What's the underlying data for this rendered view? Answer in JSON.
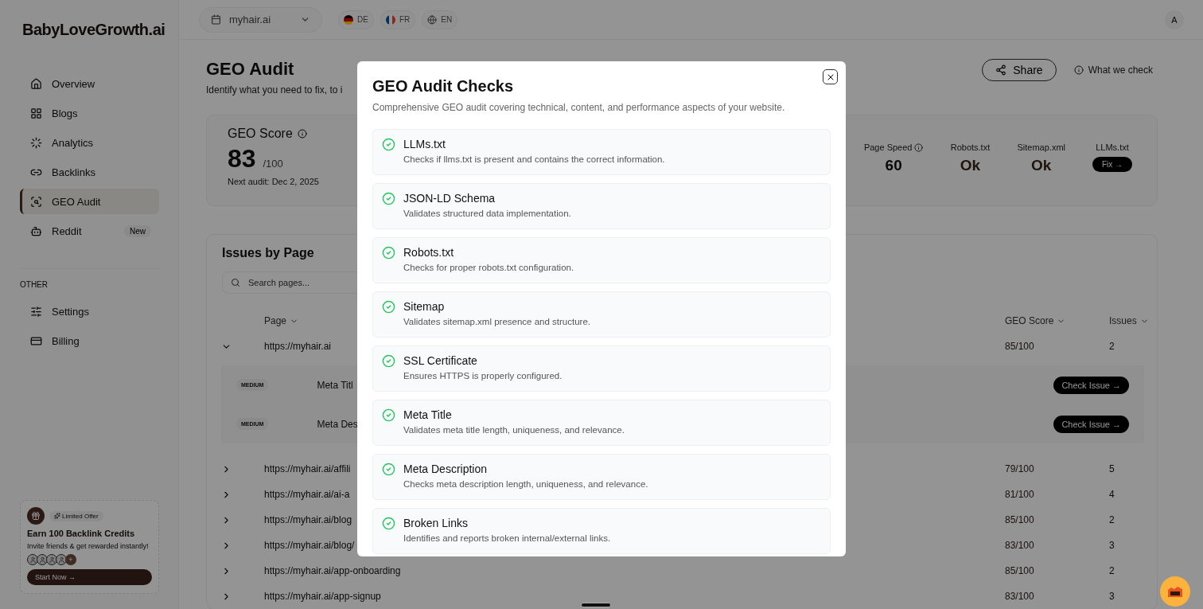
{
  "sidebar": {
    "logo": "BabyLoveGrowth.ai",
    "items": [
      {
        "label": "Overview",
        "selected": false
      },
      {
        "label": "Blogs",
        "selected": false
      },
      {
        "label": "Analytics",
        "selected": false
      },
      {
        "label": "Backlinks",
        "selected": false
      },
      {
        "label": "GEO Audit",
        "selected": true
      },
      {
        "label": "Reddit",
        "selected": false,
        "badge": "New"
      }
    ],
    "section": "OTHER",
    "other_items": [
      {
        "label": "Settings",
        "selected": false
      },
      {
        "label": "Billing",
        "selected": false
      }
    ],
    "promo": {
      "tag": "Limited Offer",
      "title": "Earn **100 Backlink Credits**",
      "text": "Invite friends & get rewarded instantly!",
      "more": "+",
      "button": "Start Now →"
    }
  },
  "topbar": {
    "site": "myhair.ai",
    "languages": [
      "DE",
      "FR",
      "EN"
    ],
    "avatar": "A"
  },
  "page": {
    "title": "GEO Audit",
    "subtitle": "Identify what you need to fix, to i",
    "share": "Share",
    "what_we_check": "What we check"
  },
  "score": {
    "label": "GEO Score",
    "value": "83",
    "max": "/100",
    "next_audit": "Next audit: Dec 2, 2025",
    "metrics": [
      {
        "label": "Page Speed",
        "value": "60",
        "kind": "number",
        "info": true
      },
      {
        "label": "Robots.txt",
        "value": "Ok",
        "kind": "status",
        "info": false
      },
      {
        "label": "Sitemap.xml",
        "value": "Ok",
        "kind": "status",
        "info": false
      },
      {
        "label": "LLMs.txt",
        "value": "Fix →",
        "kind": "button",
        "info": false
      }
    ]
  },
  "issues": {
    "title": "Issues by Page",
    "search": {
      "placeholder": "Search pages..."
    },
    "columns": [
      "Page",
      "GEO Score",
      "Issues"
    ],
    "rows": [
      {
        "page": "https://myhair.ai",
        "score": "85/100",
        "issues": "2",
        "expanded": true,
        "sub_rows": [
          {
            "severity": "MEDIUM",
            "title": "Meta Titl",
            "action": "Check Issue →"
          },
          {
            "severity": "MEDIUM",
            "title": "Meta Des",
            "action": "Check Issue →"
          }
        ]
      },
      {
        "page": "https://myhair.ai/affili",
        "score": "79/100",
        "issues": "5",
        "expanded": false
      },
      {
        "page": "https://myhair.ai/ai-a",
        "score": "81/100",
        "issues": "4",
        "expanded": false
      },
      {
        "page": "https://myhair.ai/blog",
        "score": "85/100",
        "issues": "2",
        "expanded": false
      },
      {
        "page": "https://myhair.ai/blog/",
        "score": "83/100",
        "issues": "3",
        "expanded": false
      },
      {
        "page": "https://myhair.ai/app-onboarding",
        "score": "85/100",
        "issues": "2",
        "expanded": false
      },
      {
        "page": "https://myhair.ai/app-signup",
        "score": "83/100",
        "issues": "3",
        "expanded": false
      }
    ]
  },
  "modal": {
    "title": "GEO Audit Checks",
    "description": "Comprehensive GEO audit covering technical, content, and performance aspects of your website.",
    "checks": [
      {
        "name": "LLMs.txt",
        "description": "Checks if llms.txt is present and contains the correct information.",
        "passed": true
      },
      {
        "name": "JSON-LD Schema",
        "description": "Validates structured data implementation.",
        "passed": true
      },
      {
        "name": "Robots.txt",
        "description": "Checks for proper robots.txt configuration.",
        "passed": true
      },
      {
        "name": "Sitemap",
        "description": "Validates sitemap.xml presence and structure.",
        "passed": true
      },
      {
        "name": "SSL Certificate",
        "description": "Ensures HTTPS is properly configured.",
        "passed": true
      },
      {
        "name": "Meta Title",
        "description": "Validates meta title length, uniqueness, and relevance.",
        "passed": true
      },
      {
        "name": "Meta Description",
        "description": "Checks meta description length, uniqueness, and relevance.",
        "passed": true
      },
      {
        "name": "Broken Links",
        "description": "Identifies and reports broken internal/external links.",
        "passed": true
      }
    ]
  }
}
